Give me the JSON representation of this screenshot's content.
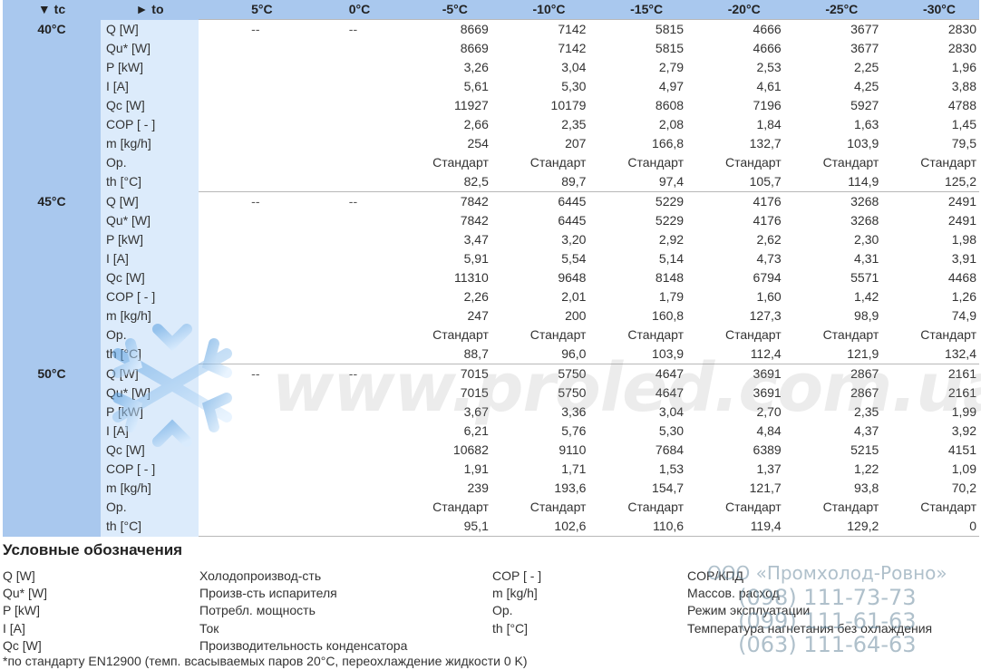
{
  "table": {
    "header": {
      "tc_label": "▼ tc",
      "to_label": "► to",
      "columns": [
        "5°C",
        "0°C",
        "-5°C",
        "-10°C",
        "-15°C",
        "-20°C",
        "-25°C",
        "-30°C"
      ]
    },
    "params": [
      "Q [W]",
      "Qu* [W]",
      "P [kW]",
      "I [A]",
      "Qc [W]",
      "COP [ - ]",
      "m [kg/h]",
      "Op.",
      "th [°C]"
    ],
    "groups": [
      {
        "tc": "40°C",
        "dash": "--",
        "rows": [
          [
            "8669",
            "7142",
            "5815",
            "4666",
            "3677",
            "2830"
          ],
          [
            "8669",
            "7142",
            "5815",
            "4666",
            "3677",
            "2830"
          ],
          [
            "3,26",
            "3,04",
            "2,79",
            "2,53",
            "2,25",
            "1,96"
          ],
          [
            "5,61",
            "5,30",
            "4,97",
            "4,61",
            "4,25",
            "3,88"
          ],
          [
            "11927",
            "10179",
            "8608",
            "7196",
            "5927",
            "4788"
          ],
          [
            "2,66",
            "2,35",
            "2,08",
            "1,84",
            "1,63",
            "1,45"
          ],
          [
            "254",
            "207",
            "166,8",
            "132,7",
            "103,9",
            "79,5"
          ],
          [
            "Стандарт",
            "Стандарт",
            "Стандарт",
            "Стандарт",
            "Стандарт",
            "Стандарт"
          ],
          [
            "82,5",
            "89,7",
            "97,4",
            "105,7",
            "114,9",
            "125,2"
          ]
        ]
      },
      {
        "tc": "45°C",
        "dash": "--",
        "rows": [
          [
            "7842",
            "6445",
            "5229",
            "4176",
            "3268",
            "2491"
          ],
          [
            "7842",
            "6445",
            "5229",
            "4176",
            "3268",
            "2491"
          ],
          [
            "3,47",
            "3,20",
            "2,92",
            "2,62",
            "2,30",
            "1,98"
          ],
          [
            "5,91",
            "5,54",
            "5,14",
            "4,73",
            "4,31",
            "3,91"
          ],
          [
            "11310",
            "9648",
            "8148",
            "6794",
            "5571",
            "4468"
          ],
          [
            "2,26",
            "2,01",
            "1,79",
            "1,60",
            "1,42",
            "1,26"
          ],
          [
            "247",
            "200",
            "160,8",
            "127,3",
            "98,9",
            "74,9"
          ],
          [
            "Стандарт",
            "Стандарт",
            "Стандарт",
            "Стандарт",
            "Стандарт",
            "Стандарт"
          ],
          [
            "88,7",
            "96,0",
            "103,9",
            "112,4",
            "121,9",
            "132,4"
          ]
        ]
      },
      {
        "tc": "50°C",
        "dash": "--",
        "rows": [
          [
            "7015",
            "5750",
            "4647",
            "3691",
            "2867",
            "2161"
          ],
          [
            "7015",
            "5750",
            "4647",
            "3691",
            "2867",
            "2161"
          ],
          [
            "3,67",
            "3,36",
            "3,04",
            "2,70",
            "2,35",
            "1,99"
          ],
          [
            "6,21",
            "5,76",
            "5,30",
            "4,84",
            "4,37",
            "3,92"
          ],
          [
            "10682",
            "9110",
            "7684",
            "6389",
            "5215",
            "4151"
          ],
          [
            "1,91",
            "1,71",
            "1,53",
            "1,37",
            "1,22",
            "1,09"
          ],
          [
            "239",
            "193,6",
            "154,7",
            "121,7",
            "93,8",
            "70,2"
          ],
          [
            "Стандарт",
            "Стандарт",
            "Стандарт",
            "Стандарт",
            "Стандарт",
            "Стандарт"
          ],
          [
            "95,1",
            "102,6",
            "110,6",
            "119,4",
            "129,2",
            "0"
          ]
        ]
      }
    ]
  },
  "legend": {
    "title": "Условные обозначения",
    "left_keys": [
      "Q [W]",
      "Qu* [W]",
      "P [kW]",
      "I [A]",
      "Qc [W]"
    ],
    "left_values": [
      "Холодопроизвод-сть",
      "Произв-сть испарителя",
      "Потребл. мощность",
      "Ток",
      "Производительность конденсатора"
    ],
    "right_keys": [
      "COP [ - ]",
      "m [kg/h]",
      "Op.",
      "th [°C]"
    ],
    "right_values": [
      "COP/КПД",
      "Массов. расход",
      "Режим эксплуатации",
      "Температура нагнетания без охлаждения"
    ],
    "footnote": "*по стандарту EN12900 (темп. всасываемых паров 20°C, переохлаждение жидкости 0 K)"
  },
  "watermark": {
    "site": "www.proled.com.ua",
    "company": "ООО «Промхолод-Ровно»",
    "phones": [
      "(098) 111-73-73",
      "(099) 111-61-63",
      "(063) 111-64-63"
    ]
  },
  "colors": {
    "header_bg": "#a9c8ee",
    "param_bg": "#dcebfb"
  }
}
